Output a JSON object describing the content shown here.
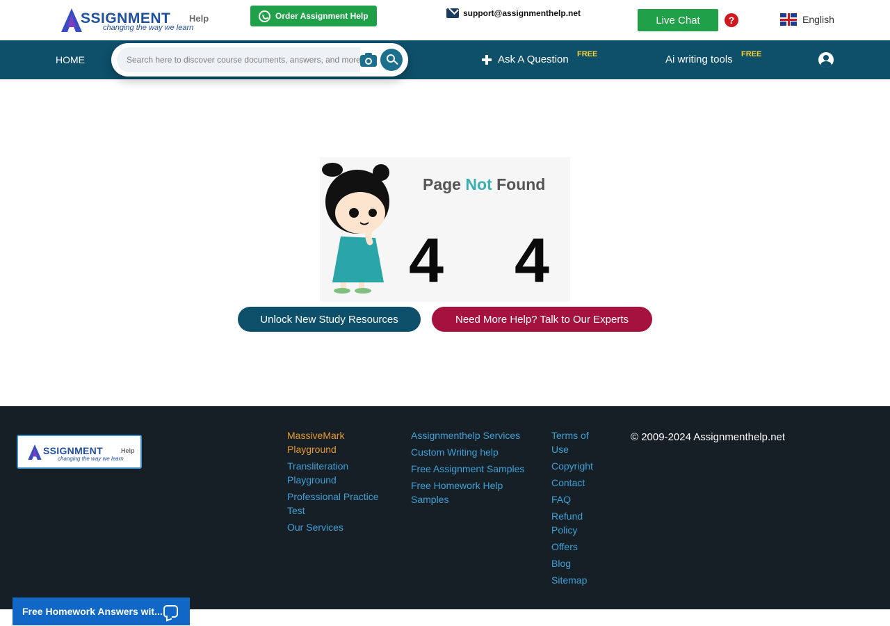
{
  "header": {
    "logo": {
      "brand": "SSIGNMENT",
      "suffix": "Help",
      "tagline": "changing the way we learn"
    },
    "order_button": "Order Assignment Help",
    "support_email": "support@assignmenthelp.net",
    "live_chat": "Live Chat",
    "language": "English"
  },
  "nav": {
    "home": "HOME",
    "search_placeholder": "Search here to discover course documents, answers, and more",
    "ask_question": "Ask A Question",
    "ask_badge": "FREE",
    "ai_tools": "Ai writing tools",
    "ai_badge": "FREE"
  },
  "error": {
    "title_part1": "Page",
    "title_part2": "Not",
    "title_part3": "Found",
    "digit1": "4",
    "digit2": "4"
  },
  "cta": {
    "study": "Unlock New Study Resources",
    "expert": "Need More Help? Talk to Our Experts"
  },
  "footer": {
    "logo": {
      "brand": "SSIGNMENT",
      "suffix": "Help",
      "tagline": "changing the way we learn"
    },
    "col1": [
      "MassiveMark Playground",
      "Transliteration Playground",
      "Professional Practice Test",
      "Our Services"
    ],
    "col2": [
      "Assignmenthelp Services",
      "Custom Writing help",
      "Free Assignment Samples",
      "Free Homework Help Samples"
    ],
    "col3": [
      "Terms of Use",
      "Copyright",
      "Contact",
      "FAQ",
      "Refund Policy",
      "Offers",
      "Blog",
      "Sitemap"
    ],
    "copyright": "© 2009-2024 Assignmenthelp.net"
  },
  "chat_widget": "Free Homework Answers wit...",
  "colors": {
    "nav": "#0e4f6a",
    "green": "#21a04a",
    "expert_button": "#a5123e",
    "footer": "#171f26",
    "link": "#3ea0d6",
    "link_highlight": "#e79a25",
    "badge": "#f5d33c"
  }
}
